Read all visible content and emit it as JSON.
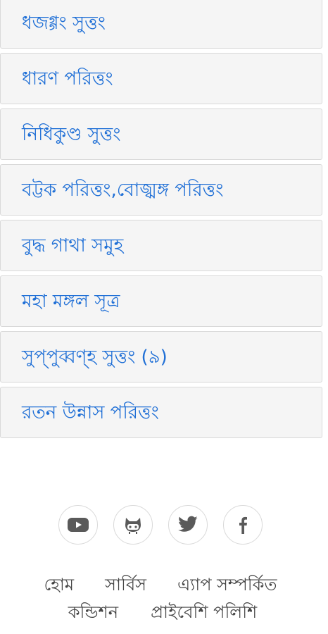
{
  "list": {
    "items": [
      {
        "label": "ধজগ্গং সুত্তং"
      },
      {
        "label": "ধারণ পরিত্তং"
      },
      {
        "label": "নিধিকুণ্ড সুত্তং"
      },
      {
        "label": "বট্টক পরিত্তং,বোজ্ঝঙ্গ পরিত্তং"
      },
      {
        "label": "বুদ্ধ গাথা সমুহ"
      },
      {
        "label": "মহা মঙ্গল সূত্র"
      },
      {
        "label": "সুপ্‌পুব্বণ্‌হ সুত্তং (৯)"
      },
      {
        "label": "রতন উন্নাস পরিত্তং"
      }
    ]
  },
  "social": {
    "icons": [
      "youtube-icon",
      "github-icon",
      "twitter-icon",
      "facebook-icon"
    ],
    "icon_color": "#5a5a5a"
  },
  "footer": {
    "row1": [
      "হোম",
      "সার্বিস",
      "এ্যাপ সম্পর্কিত"
    ],
    "row2": [
      "কন্ডিশন",
      "প্রাইবেশি পলিশি"
    ]
  },
  "colors": {
    "link": "#1f6fd6",
    "item_bg": "#f5f5f5",
    "border": "#d9d9d9",
    "footer_text": "#444444"
  }
}
